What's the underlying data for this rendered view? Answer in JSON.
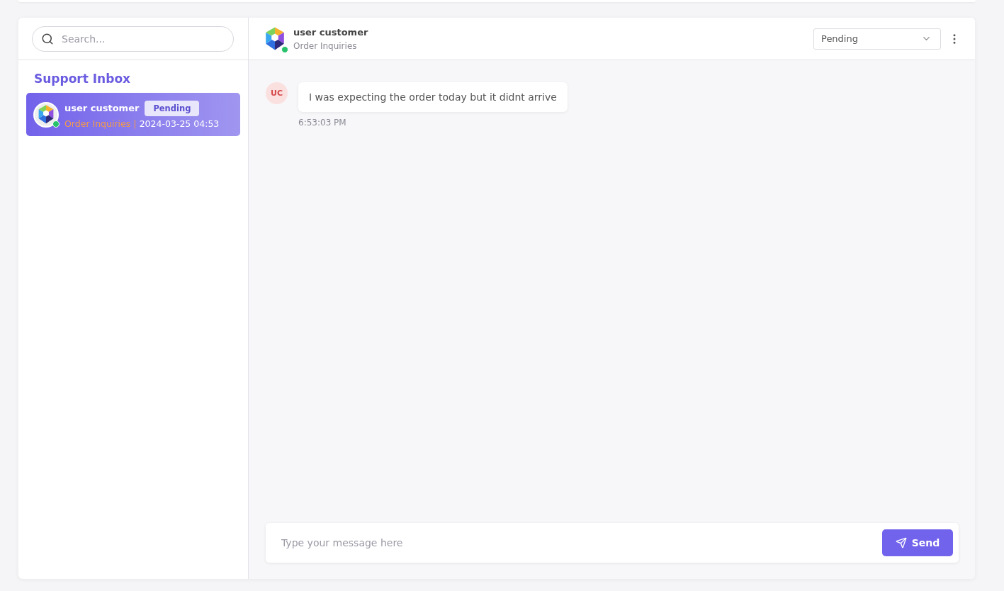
{
  "search": {
    "placeholder": "Search..."
  },
  "inbox": {
    "title": "Support Inbox",
    "conversations": [
      {
        "name": "user customer",
        "status": "Pending",
        "category": "Order Inquiries",
        "separator": "|",
        "time": "2024-03-25 04:53",
        "selected": true,
        "online": true
      }
    ]
  },
  "chat_header": {
    "name": "user customer",
    "category": "Order Inquiries",
    "online": true,
    "status_select": "Pending"
  },
  "messages": [
    {
      "initials": "UC",
      "text": "I was expecting the order today but it didnt arrive",
      "time": "6:53:03 PM"
    }
  ],
  "composer": {
    "placeholder": "Type your message here",
    "send": "Send"
  }
}
